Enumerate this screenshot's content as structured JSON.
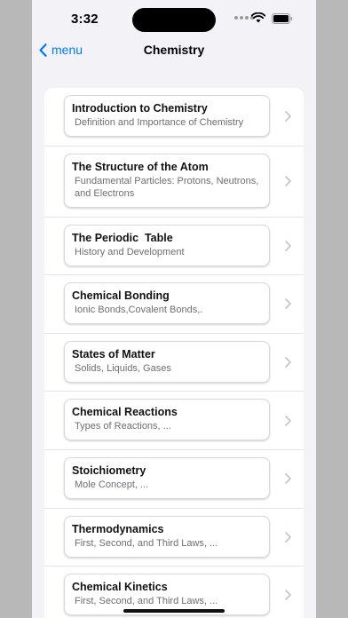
{
  "status": {
    "time": "3:32"
  },
  "nav": {
    "back_label": "menu",
    "title": "Chemistry"
  },
  "topics": [
    {
      "title": "Introduction to Chemistry",
      "subtitle": "Definition and Importance of Chemistry"
    },
    {
      "title": "The Structure of the Atom",
      "subtitle": "Fundamental Particles: Protons, Neutrons, and Electrons"
    },
    {
      "title": "The Periodic  Table",
      "subtitle": "History and Development"
    },
    {
      "title": "Chemical Bonding",
      "subtitle": "Ionic Bonds,Covalent Bonds,."
    },
    {
      "title": "States of Matter",
      "subtitle": "Solids, Liquids, Gases"
    },
    {
      "title": "Chemical Reactions",
      "subtitle": "Types of Reactions, ..."
    },
    {
      "title": "Stoichiometry",
      "subtitle": "Mole Concept, ..."
    },
    {
      "title": "Thermodynamics",
      "subtitle": "First, Second, and Third Laws, ..."
    },
    {
      "title": "Chemical Kinetics",
      "subtitle": "First, Second, and Third Laws, ..."
    }
  ],
  "icons": {
    "back": "chevron-left-icon",
    "row": "chevron-right-icon"
  },
  "colors": {
    "accent": "#007aff",
    "background": "#f2f2f7"
  }
}
